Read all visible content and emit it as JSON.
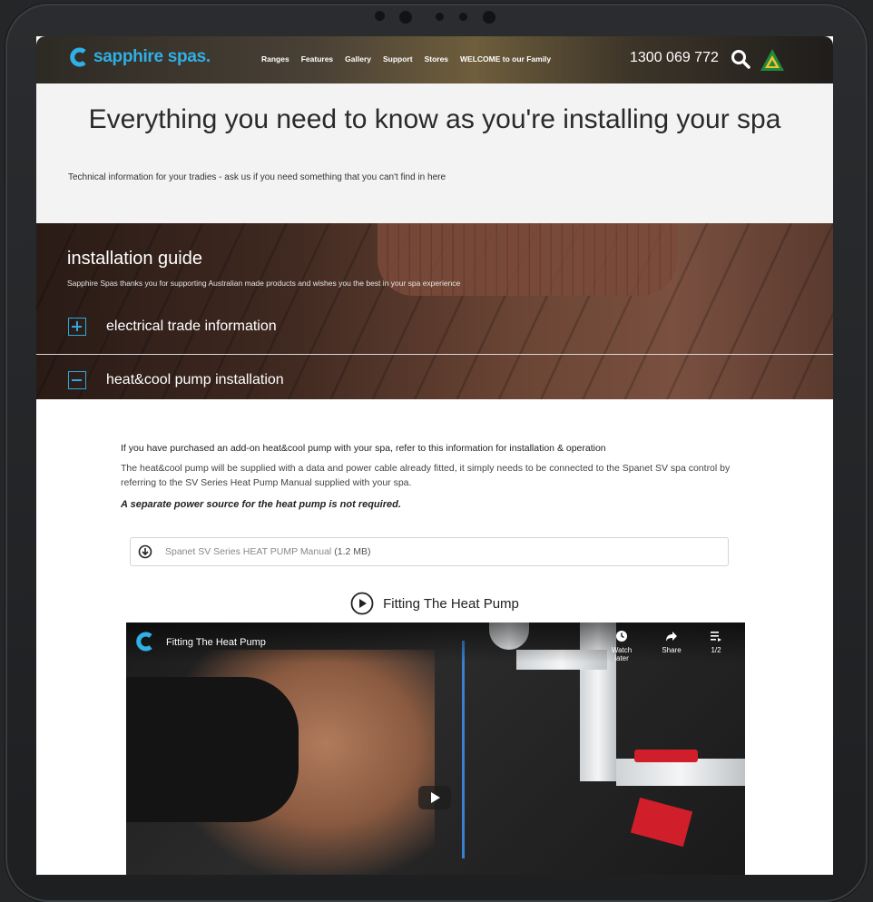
{
  "site": {
    "logo_text": "sapphire spas.",
    "nav": [
      "Ranges",
      "Features",
      "Gallery",
      "Support",
      "Stores",
      "WELCOME to our Family"
    ],
    "phone": "1300 069 772"
  },
  "hero": {
    "title": "Everything you need to know as you're installing your spa",
    "subtitle": "Technical information for your tradies - ask us if you need something that you can't find in here"
  },
  "installation": {
    "heading": "installation guide",
    "subtitle": "Sapphire Spas thanks you for supporting Australian made products and wishes you the best in your spa experience",
    "accordion": [
      {
        "label": "electrical trade information",
        "state": "collapsed",
        "icon": "plus-icon"
      },
      {
        "label": "heat&cool pump installation",
        "state": "expanded",
        "icon": "minus-icon"
      }
    ]
  },
  "heatpump": {
    "intro_bold": "If you have purchased an add-on heat&cool pump with your spa, refer to this information for installation & operation",
    "body": "The heat&cool pump will be supplied with a data and power cable already fitted, it simply needs to be connected to the Spanet SV spa control by referring to the SV Series Heat Pump Manual supplied with your spa.",
    "note": "A separate power source for the heat pump is not required.",
    "download": {
      "name": "Spanet SV Series HEAT PUMP Manual",
      "size": "(1.2 MB)"
    },
    "video_heading": "Fitting The Heat Pump",
    "video": {
      "title": "Fitting The Heat Pump",
      "watch_later": "Watch later",
      "share": "Share",
      "playlist": "1/2"
    }
  },
  "colors": {
    "accent": "#2fa8de",
    "logo": "#2fb0e6"
  }
}
